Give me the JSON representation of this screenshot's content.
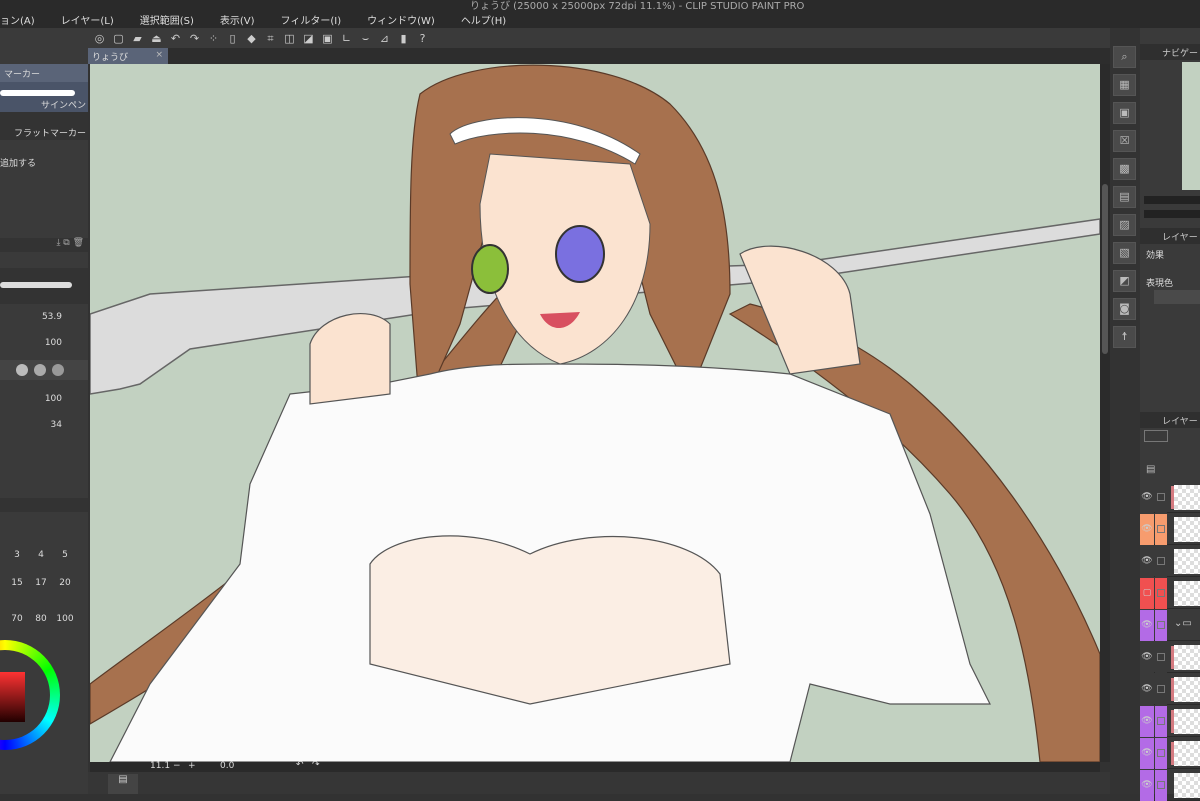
{
  "window": {
    "title": "りょうび (25000 x 25000px 72dpi 11.1%) - CLIP STUDIO PAINT PRO"
  },
  "menu": [
    "ョン(A)",
    "レイヤー(L)",
    "選択範囲(S)",
    "表示(V)",
    "フィルター(I)",
    "ウィンドウ(W)",
    "ヘルプ(H)"
  ],
  "document_tab": {
    "label": "りょうび",
    "close": "×"
  },
  "sub_tool": {
    "group": "マーカー",
    "items": [
      "サインペン",
      "フラットマーカー"
    ],
    "add_label": "追加する"
  },
  "tool_property": {
    "size": "53.9",
    "opacity": "100",
    "density": "100",
    "value4": "34"
  },
  "brush_sizes": [
    "3",
    "4",
    "5",
    "15",
    "17",
    "20",
    "70",
    "80",
    "100"
  ],
  "status": {
    "zoom": "11.1",
    "angle": "0.0",
    "minus": "−",
    "plus": "+"
  },
  "right_panels": {
    "navigator": "ナビゲー",
    "layer_property": "レイヤー",
    "effect": "効果",
    "expression_color": "表現色",
    "layers": "レイヤー"
  },
  "layer_colors": [
    "#3a3a3a",
    "#f79c6e",
    "#3a3a3a",
    "#f05050",
    "#b36be6",
    "#3a3a3a",
    "#3a3a3a",
    "#b36be6",
    "#b36be6",
    "#b36be6"
  ],
  "colors": {
    "canvas_bg": "#c2d1c1",
    "hair": "#a7714e",
    "accent": "#5a6478"
  }
}
